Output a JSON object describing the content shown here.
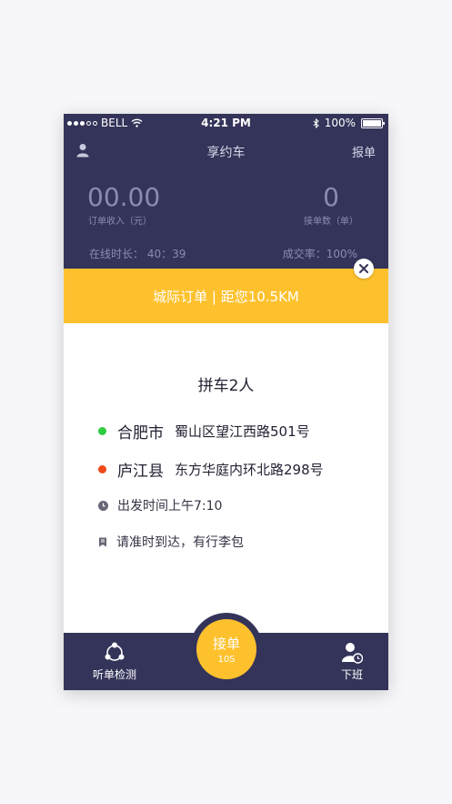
{
  "status_bar": {
    "carrier": "BELL",
    "time": "4:21 PM",
    "battery": "100%"
  },
  "nav": {
    "title": "享约车",
    "report_label": "报单"
  },
  "stats": {
    "income_value": "00.00",
    "income_label": "订单收入（元）",
    "orders_value": "0",
    "orders_label": "接单数（单）",
    "online_time": "在线时长： 40：39",
    "success_rate": "成交率：100%"
  },
  "order": {
    "banner": "城际订单 | 距您10.5KM",
    "carpool": "拼车2人",
    "from_city": "合肥市",
    "from_street": "蜀山区望江西路501号",
    "to_city": "庐江县",
    "to_street": "东方华庭内环北路298号",
    "departure": "出发时间上午7:10",
    "note": "请准时到达，有行李包"
  },
  "tabbar": {
    "listen_label": "听单检测",
    "accept_label": "接单",
    "countdown": "10S",
    "offwork_label": "下班"
  },
  "colors": {
    "navy": "#34345a",
    "accent_yellow": "#fec12e",
    "origin_green": "#2ecc40",
    "dest_orange": "#f04a1c"
  },
  "icons": [
    "user-icon",
    "wifi-icon",
    "bluetooth-icon",
    "battery-icon",
    "close-icon",
    "clock-icon",
    "note-icon",
    "listen-icon",
    "offwork-icon"
  ]
}
